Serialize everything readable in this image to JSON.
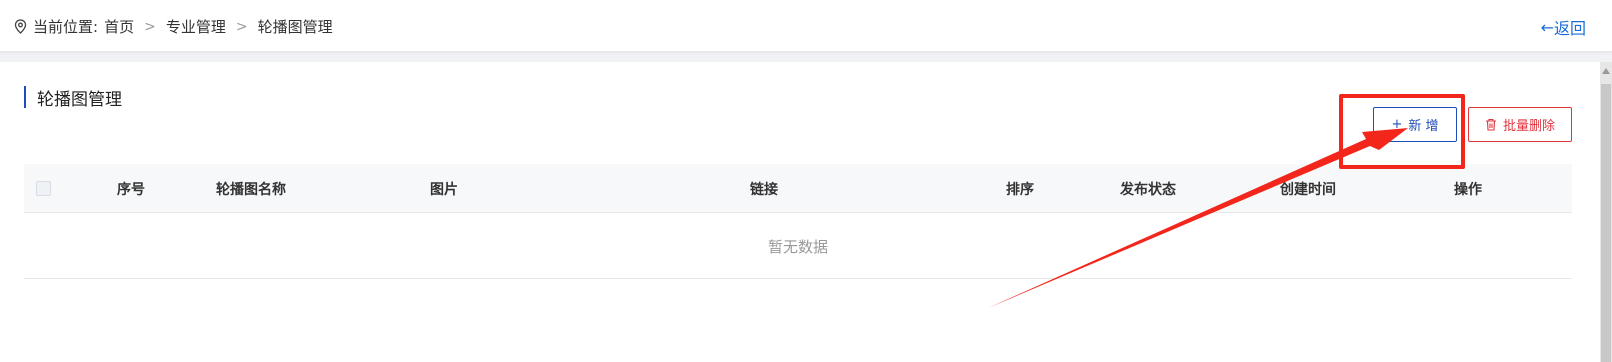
{
  "breadcrumb": {
    "prefix": "当前位置:",
    "items": [
      "首页",
      "专业管理",
      "轮播图管理"
    ],
    "separator": ">"
  },
  "back": {
    "arrow": "←",
    "label": "返回"
  },
  "page": {
    "title": "轮播图管理"
  },
  "toolbar": {
    "add_icon": "+",
    "add_label": "新 增",
    "delete_label": "批量删除"
  },
  "table": {
    "columns": [
      "序号",
      "轮播图名称",
      "图片",
      "链接",
      "排序",
      "发布状态",
      "创建时间",
      "操作"
    ],
    "empty_text": "暂无数据"
  },
  "colors": {
    "primary": "#1f4db8",
    "danger": "#e0353f",
    "annotation": "#f3261c"
  },
  "icons": {
    "location": "location-pin-icon",
    "chevron": "chevron-right-icon",
    "back": "arrow-left-icon",
    "add": "plus-icon",
    "delete": "trash-icon"
  }
}
